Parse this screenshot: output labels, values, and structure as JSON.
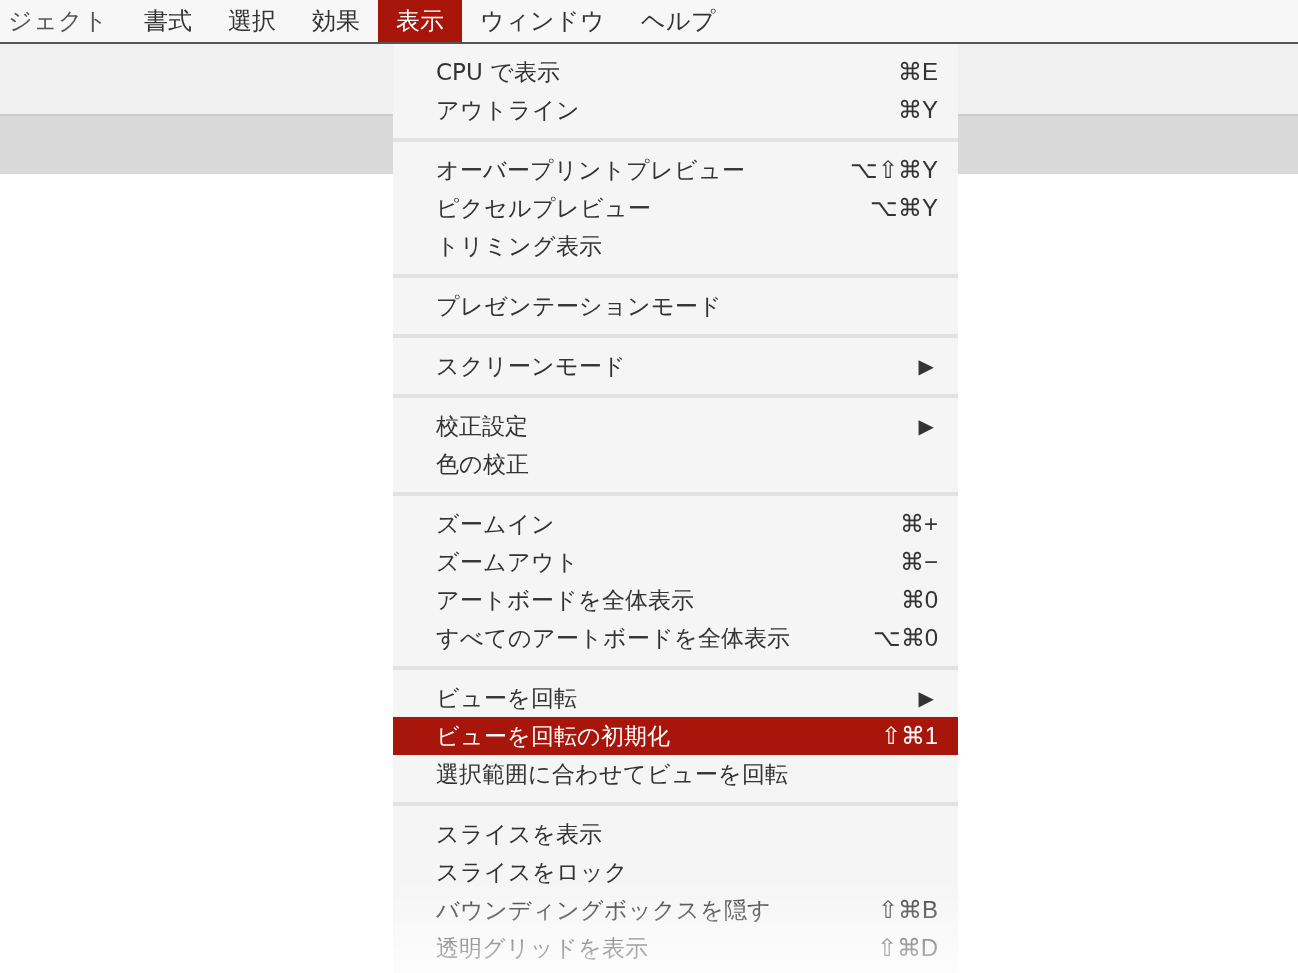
{
  "menubar": [
    {
      "label": "ジェクト",
      "selected": false
    },
    {
      "label": "書式",
      "selected": false
    },
    {
      "label": "選択",
      "selected": false
    },
    {
      "label": "効果",
      "selected": false
    },
    {
      "label": "表示",
      "selected": true
    },
    {
      "label": "ウィンドウ",
      "selected": false
    },
    {
      "label": "ヘルプ",
      "selected": false
    }
  ],
  "menu": {
    "groups": [
      [
        {
          "label": "CPU で表示",
          "shortcut": "⌘E",
          "selected": false
        },
        {
          "label": "アウトライン",
          "shortcut": "⌘Y",
          "selected": false
        }
      ],
      [
        {
          "label": "オーバープリントプレビュー",
          "shortcut": "⌥⇧⌘Y",
          "selected": false
        },
        {
          "label": "ピクセルプレビュー",
          "shortcut": "⌥⌘Y",
          "selected": false
        },
        {
          "label": "トリミング表示",
          "selected": false
        }
      ],
      [
        {
          "label": "プレゼンテーションモード",
          "selected": false
        }
      ],
      [
        {
          "label": "スクリーンモード",
          "submenu": "▶",
          "selected": false
        }
      ],
      [
        {
          "label": "校正設定",
          "submenu": "▶",
          "selected": false
        },
        {
          "label": "色の校正",
          "selected": false
        }
      ],
      [
        {
          "label": "ズームイン",
          "shortcut": "⌘+",
          "selected": false
        },
        {
          "label": "ズームアウト",
          "shortcut": "⌘−",
          "selected": false
        },
        {
          "label": "アートボードを全体表示",
          "shortcut": "⌘0",
          "selected": false
        },
        {
          "label": "すべてのアートボードを全体表示",
          "shortcut": "⌥⌘0",
          "selected": false
        }
      ],
      [
        {
          "label": "ビューを回転",
          "submenu": "▶",
          "selected": false
        },
        {
          "label": "ビューを回転の初期化",
          "shortcut": "⇧⌘1",
          "selected": true
        },
        {
          "label": "選択範囲に合わせてビューを回転",
          "selected": false
        }
      ],
      [
        {
          "label": "スライスを表示",
          "selected": false
        },
        {
          "label": "スライスをロック",
          "selected": false
        },
        {
          "label": "バウンディングボックスを隠す",
          "shortcut": "⇧⌘B",
          "selected": false
        },
        {
          "label": "透明グリッドを表示",
          "shortcut": "⇧⌘D",
          "selected": false
        }
      ]
    ]
  }
}
